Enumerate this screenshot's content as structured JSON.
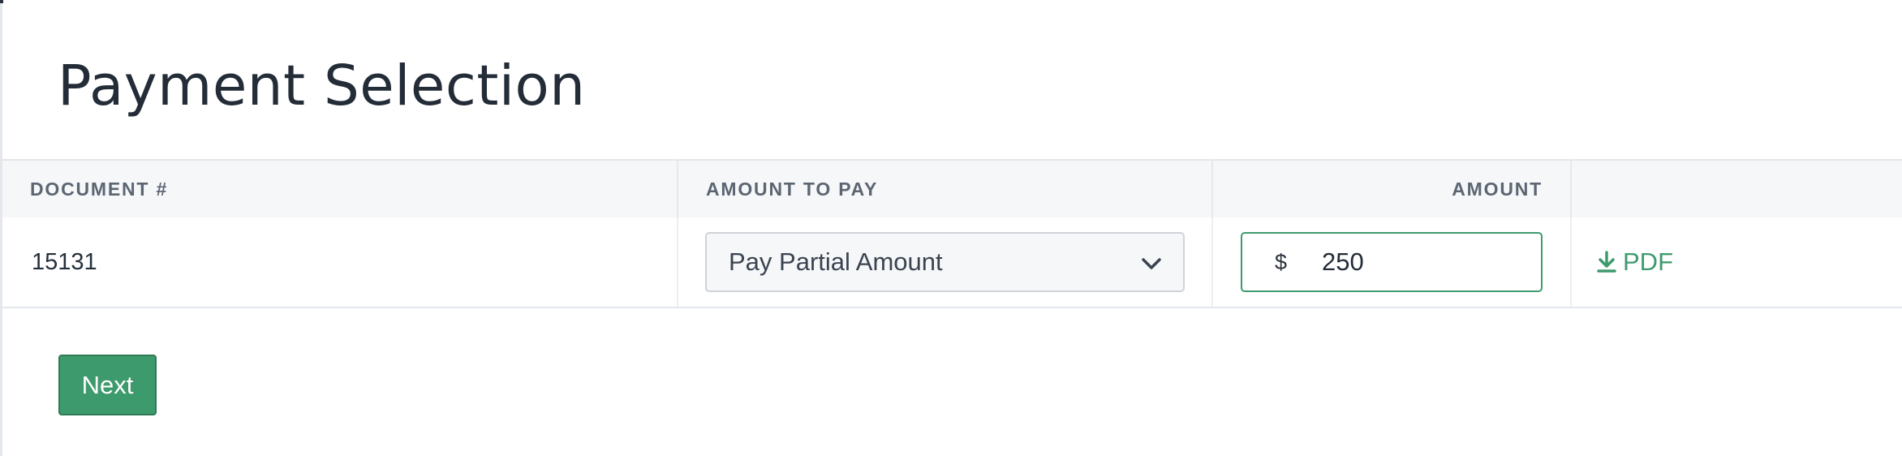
{
  "page": {
    "title": "Payment Selection"
  },
  "table": {
    "headers": {
      "document": "DOCUMENT #",
      "amount_to_pay": "AMOUNT TO PAY",
      "amount": "AMOUNT",
      "actions": ""
    },
    "rows": [
      {
        "document_number": "15131",
        "amount_to_pay_selected": "Pay Partial Amount",
        "currency_symbol": "$",
        "amount_value": "250",
        "pdf_label": "PDF"
      }
    ]
  },
  "actions": {
    "next_label": "Next"
  },
  "colors": {
    "accent": "#3d9a6c",
    "header_bg": "#f6f7f9",
    "text": "#232c37"
  },
  "icons": {
    "dropdown": "chevron-down-icon",
    "download": "download-icon"
  }
}
